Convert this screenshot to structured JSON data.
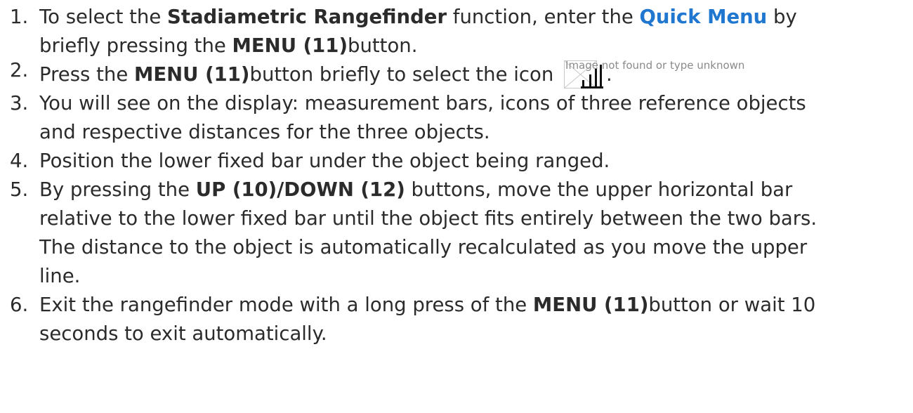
{
  "steps": [
    {
      "number": "1.",
      "t1": "To select the ",
      "b1": "Stadiametric Rangefinder",
      "t2": " function, enter the ",
      "link": "Quick Menu",
      "t3": " by briefly pressing the ",
      "b2": "MENU (11)",
      "t4": "button."
    },
    {
      "number": "2.",
      "t1": "Press the ",
      "b1": "MENU (11)",
      "t2": "button briefly to select the icon ",
      "img_alt": "Image not found or type unknown",
      "t3": "."
    },
    {
      "number": "3.",
      "text": "You will see on the display: measurement bars, icons of three reference objects and respective distances for the three objects."
    },
    {
      "number": "4.",
      "text": "Position the lower fixed bar under the object being ranged."
    },
    {
      "number": "5.",
      "t1": "By pressing the ",
      "b1": "UP (10)/DOWN (12)",
      "t2": " buttons, move the upper horizontal bar relative to the lower fixed bar until the object fits entirely between the two bars. The distance to the object is automatically recalculated as you move the upper line."
    },
    {
      "number": "6.",
      "t1": "Exit the rangefinder mode with a long press of the ",
      "b1": "MENU (11)",
      "t2": "button or wait 10 seconds to exit automatically."
    }
  ],
  "colors": {
    "text": "#2b2b2b",
    "link": "#1f77d0",
    "alt_text": "#8a8a8a"
  },
  "icons": {
    "broken_image": "broken-image-icon",
    "signal_bars": "signal-bars-icon"
  }
}
